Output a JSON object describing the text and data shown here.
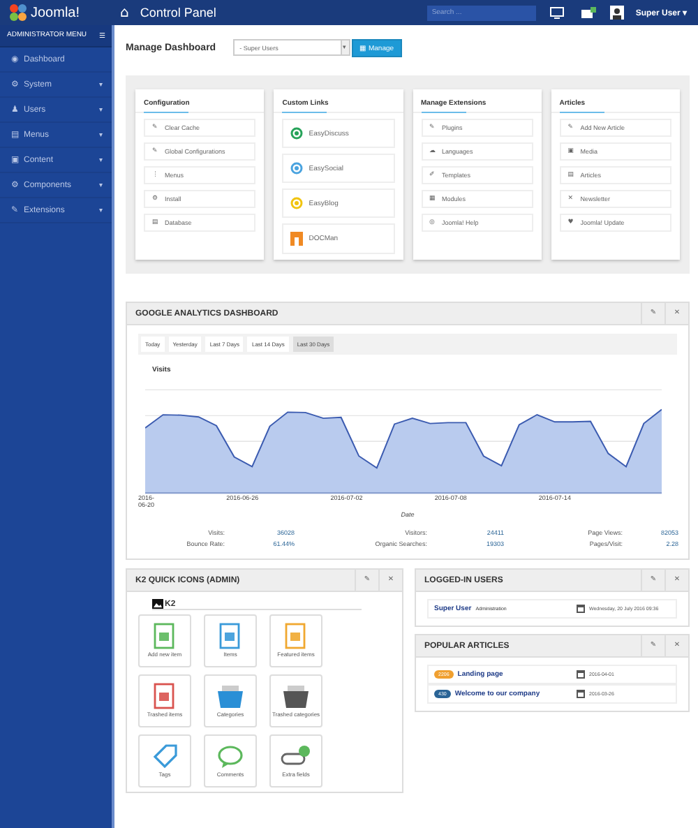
{
  "header": {
    "brand": "Joomla!",
    "home_icon": "⌂",
    "title": "Control Panel",
    "search": {
      "placeholder": "Search ..."
    },
    "user": "Super User",
    "user_caret": "▾"
  },
  "sidebar": {
    "title": "ADMINISTRATOR MENU",
    "menu_icon": "☰",
    "items": [
      {
        "icon": "◉",
        "label": "Dashboard",
        "expandable": false
      },
      {
        "icon": "⚙",
        "label": "System",
        "expandable": true
      },
      {
        "icon": "♟",
        "label": "Users",
        "expandable": true
      },
      {
        "icon": "▤",
        "label": "Menus",
        "expandable": true
      },
      {
        "icon": "▣",
        "label": "Content",
        "expandable": true
      },
      {
        "icon": "⚙",
        "label": "Components",
        "expandable": true
      },
      {
        "icon": "✎",
        "label": "Extensions",
        "expandable": true
      }
    ],
    "caret": "▾"
  },
  "manage": {
    "label": "Manage Dashboard",
    "select": "- Super Users",
    "select_caret": "▾",
    "button_icon": "▦",
    "button": "Manage"
  },
  "quick_cards": [
    {
      "title": "Configuration",
      "items": [
        {
          "kind": "glyph",
          "icon": "✎",
          "label": "Clear Cache"
        },
        {
          "kind": "glyph",
          "icon": "✎",
          "label": "Global Configurations"
        },
        {
          "kind": "glyph",
          "icon": "⋮",
          "label": "Menus"
        },
        {
          "kind": "glyph",
          "icon": "⚙",
          "label": "Install"
        },
        {
          "kind": "glyph",
          "icon": "▤",
          "label": "Database"
        }
      ]
    },
    {
      "title": "Custom Links",
      "items": [
        {
          "kind": "ring",
          "color": "#27a35a",
          "label": "EasyDiscuss"
        },
        {
          "kind": "ring",
          "color": "#4aa3df",
          "label": "EasySocial"
        },
        {
          "kind": "ring",
          "color": "#f1c40f",
          "label": "EasyBlog"
        },
        {
          "kind": "door",
          "color": "#f08a24",
          "label": "DOCMan"
        }
      ]
    },
    {
      "title": "Manage Extensions",
      "items": [
        {
          "kind": "glyph",
          "icon": "✎",
          "label": "Plugins"
        },
        {
          "kind": "glyph",
          "icon": "☁",
          "label": "Languages"
        },
        {
          "kind": "glyph",
          "icon": "✐",
          "label": "Templates"
        },
        {
          "kind": "glyph",
          "icon": "▦",
          "label": "Modules"
        },
        {
          "kind": "glyph",
          "icon": "◎",
          "label": "Joomla! Help"
        }
      ]
    },
    {
      "title": "Articles",
      "items": [
        {
          "kind": "glyph",
          "icon": "✎",
          "label": "Add New Article"
        },
        {
          "kind": "glyph",
          "icon": "▣",
          "label": "Media"
        },
        {
          "kind": "glyph",
          "icon": "▤",
          "label": "Articles"
        },
        {
          "kind": "glyph",
          "icon": "✕",
          "label": "Newsletter"
        },
        {
          "kind": "glyph",
          "icon": "♥",
          "label": "Joomla! Update"
        }
      ]
    }
  ],
  "analytics": {
    "title": "GOOGLE ANALYTICS DASHBOARD",
    "edit_icon": "✎",
    "close_icon": "✕",
    "ranges": [
      {
        "label": "Today",
        "selected": false
      },
      {
        "label": "Yesterday",
        "selected": false
      },
      {
        "label": "Last 7 Days",
        "selected": false
      },
      {
        "label": "Last 14 Days",
        "selected": false
      },
      {
        "label": "Last 30 Days",
        "selected": true
      }
    ],
    "chart_title": "Visits",
    "x_labels": [
      "2016-\n06-20",
      "2016-06-26",
      "2016-07-02",
      "2016-07-08",
      "2016-07-14"
    ],
    "x_title": "Date",
    "stats": [
      {
        "label": "Visits:",
        "value": "36028"
      },
      {
        "label": "Visitors:",
        "value": "24411"
      },
      {
        "label": "Page Views:",
        "value": "82053"
      },
      {
        "label": "Bounce Rate:",
        "value": "61.44%"
      },
      {
        "label": "Organic Searches:",
        "value": "19303"
      },
      {
        "label": "Pages/Visit:",
        "value": "2.28"
      }
    ]
  },
  "k2": {
    "title": "K2 QUICK ICONS (ADMIN)",
    "edit_icon": "✎",
    "close_icon": "✕",
    "logo": "K2",
    "tiles": [
      {
        "kind": "doc",
        "color": "#5cb85c",
        "label": "Add new item"
      },
      {
        "kind": "doc",
        "color": "#3a9ad9",
        "label": "Items"
      },
      {
        "kind": "doc",
        "color": "#f0a830",
        "label": "Featured items"
      },
      {
        "kind": "doc",
        "color": "#d9534f",
        "label": "Trashed items"
      },
      {
        "kind": "basket",
        "color": "#2a8fd6",
        "label": "Categories"
      },
      {
        "kind": "basket",
        "color": "#555555",
        "label": "Trashed categories"
      },
      {
        "kind": "tag",
        "color": "#3a9ad9",
        "label": "Tags"
      },
      {
        "kind": "bubble",
        "color": "#5cb85c",
        "label": "Comments"
      },
      {
        "kind": "toggle",
        "color": "#5cb85c",
        "label": "Extra fields"
      }
    ]
  },
  "logged_in": {
    "title": "LOGGED-IN USERS",
    "edit_icon": "✎",
    "close_icon": "✕",
    "rows": [
      {
        "name": "Super User",
        "role": "Administration",
        "date": "Wednesday, 20 July 2016 09:36"
      }
    ]
  },
  "popular": {
    "title": "POPULAR ARTICLES",
    "edit_icon": "✎",
    "close_icon": "✕",
    "rows": [
      {
        "hits": "2206",
        "color": "#f0a030",
        "title": "Landing page",
        "date": "2016-04-01"
      },
      {
        "hits": "430",
        "color": "#2a6496",
        "title": "Welcome to our company",
        "date": "2016-03-26"
      }
    ]
  }
}
